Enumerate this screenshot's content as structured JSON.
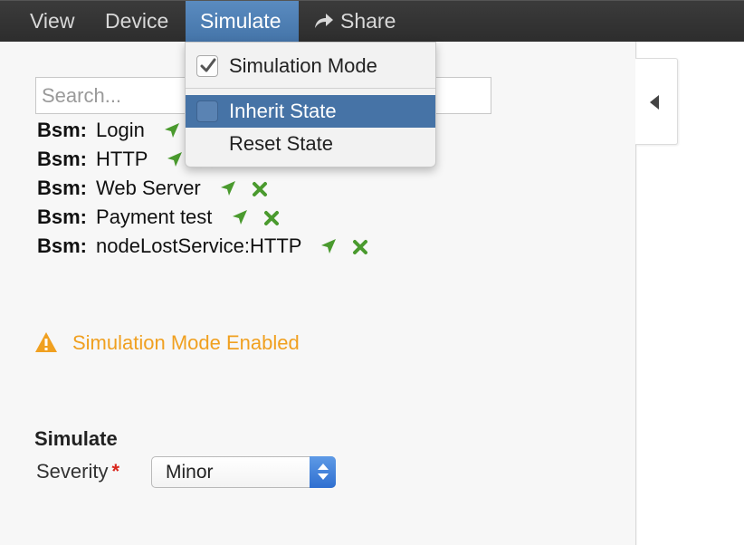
{
  "menubar": {
    "items": [
      {
        "label": "View"
      },
      {
        "label": "Device"
      },
      {
        "label": "Simulate"
      },
      {
        "label": "Share",
        "icon": "share-arrow-icon"
      }
    ],
    "active": "Simulate"
  },
  "search": {
    "placeholder": "Search...",
    "value": ""
  },
  "bsm_list": {
    "prefix": "Bsm:",
    "items": [
      {
        "name": "Login"
      },
      {
        "name": "HTTP"
      },
      {
        "name": "Web Server"
      },
      {
        "name": "Payment test"
      },
      {
        "name": "nodeLostService:HTTP"
      }
    ],
    "icon_color": "#4a9a2e"
  },
  "warning": {
    "text": "Simulation Mode Enabled",
    "color": "#f0a020",
    "icon": "warning-triangle-icon"
  },
  "simulate_form": {
    "heading": "Simulate",
    "severity_label": "Severity",
    "required_marker": "*",
    "severity_value": "Minor"
  },
  "simulate_menu": {
    "items": [
      {
        "label": "Simulation Mode",
        "checked": true
      },
      {
        "label": "Inherit State",
        "checked": false,
        "highlighted": true
      },
      {
        "label": "Reset State"
      }
    ]
  },
  "colors": {
    "menubar": "#333333",
    "active_menu": "#4c7cb0",
    "highlight": "#4673a6"
  }
}
